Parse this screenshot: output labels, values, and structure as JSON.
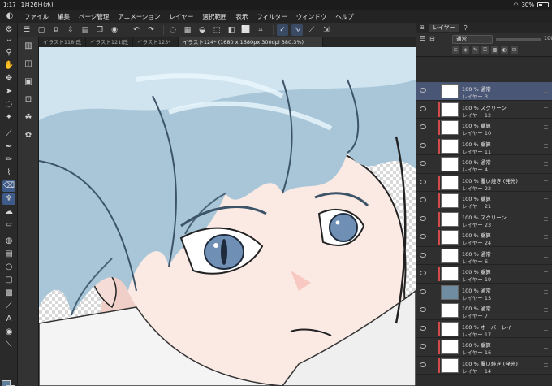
{
  "status": {
    "time": "1:17",
    "date": "1月26日(水)",
    "battery": "30%",
    "battery_fraction": 0.3
  },
  "menu": [
    "ファイル",
    "編集",
    "ページ管理",
    "アニメーション",
    "レイヤー",
    "選択範囲",
    "表示",
    "フィルター",
    "ウィンドウ",
    "ヘルプ"
  ],
  "tabs": [
    "イラスト118(改",
    "イラスト121(改",
    "イラスト123*",
    "イラスト124* (1680 x 1680px 300dpi 380.3%)"
  ],
  "right_tabs": [
    "レイヤー"
  ],
  "layer_header": {
    "blend": "通常",
    "opacity": "100"
  },
  "layers": [
    {
      "mode": "100 % 通常",
      "name": "レイヤー 3",
      "thumb": "#ffffff",
      "clip": false,
      "selected": true
    },
    {
      "mode": "100 % スクリーン",
      "name": "レイヤー 12",
      "thumb": "#ffffff",
      "clip": true
    },
    {
      "mode": "100 % 乗算",
      "name": "レイヤー 10",
      "thumb": "#ffffff",
      "clip": true
    },
    {
      "mode": "100 % 乗算",
      "name": "レイヤー 11",
      "thumb": "#ffffff",
      "clip": true
    },
    {
      "mode": "100 % 通常",
      "name": "レイヤー 4",
      "thumb": "#ffffff",
      "clip": false
    },
    {
      "mode": "100 % 覆い焼き (発光)",
      "name": "レイヤー 22",
      "thumb": "#ffffff",
      "clip": true
    },
    {
      "mode": "100 % 乗算",
      "name": "レイヤー 21",
      "thumb": "#ffffff",
      "clip": true
    },
    {
      "mode": "100 % スクリーン",
      "name": "レイヤー 23",
      "thumb": "#ffffff",
      "clip": true
    },
    {
      "mode": "100 % 乗算",
      "name": "レイヤー 24",
      "thumb": "#ffffff",
      "clip": true
    },
    {
      "mode": "100 % 通常",
      "name": "レイヤー 6",
      "thumb": "#ffffff",
      "clip": false
    },
    {
      "mode": "100 % 乗算",
      "name": "レイヤー 19",
      "thumb": "#ffffff",
      "clip": true
    },
    {
      "mode": "100 % 通常",
      "name": "レイヤー 13",
      "thumb": "#6f8ca0",
      "clip": false
    },
    {
      "mode": "100 % 通常",
      "name": "レイヤー 7",
      "thumb": "#ffffff",
      "clip": false
    },
    {
      "mode": "100 % オーバーレイ",
      "name": "レイヤー 17",
      "thumb": "#ffffff",
      "clip": true
    },
    {
      "mode": "100 % 乗算",
      "name": "レイヤー 16",
      "thumb": "#ffffff",
      "clip": true
    },
    {
      "mode": "100 % 覆い焼き (発光)",
      "name": "レイヤー 14",
      "thumb": "#ffffff",
      "clip": true
    }
  ]
}
